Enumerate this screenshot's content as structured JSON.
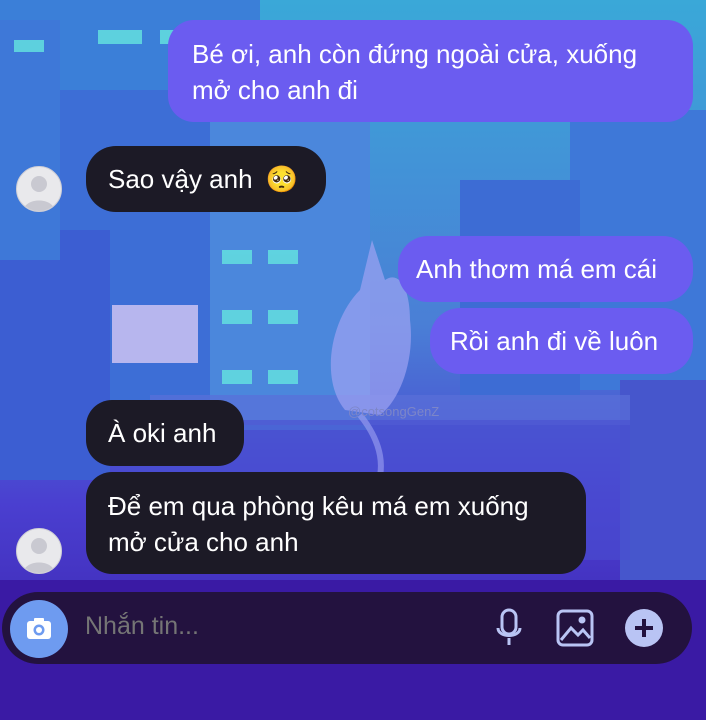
{
  "colors": {
    "sent_bubble": "#6b5cf0",
    "received_bubble": "#1c1a26",
    "composer_bg": "#23123f",
    "camera_button": "#6e9bf0"
  },
  "watermark": "@cotsongGenZ",
  "messages": [
    {
      "from": "me",
      "text": "Bé ơi, anh còn đứng ngoài cửa, xuống mở cho anh đi"
    },
    {
      "from": "other",
      "text": "Sao vậy anh",
      "emoji": "🥺"
    },
    {
      "from": "me",
      "text": "Anh thơm má em cái"
    },
    {
      "from": "me",
      "text": "Rồi anh đi về luôn"
    },
    {
      "from": "other",
      "text": "À oki anh"
    },
    {
      "from": "other",
      "text": "Để em qua phòng kêu má em xuống mở cửa cho anh"
    }
  ],
  "composer": {
    "placeholder": "Nhắn tin...",
    "icons": [
      "camera-icon",
      "microphone-icon",
      "image-icon",
      "plus-icon"
    ]
  }
}
